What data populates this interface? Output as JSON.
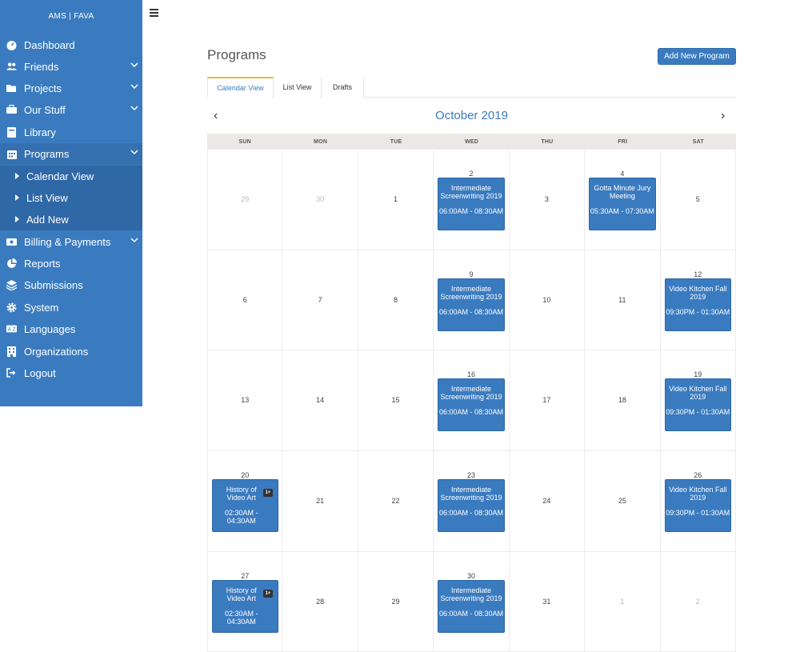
{
  "brand": "AMS  |  FAVA",
  "nav": {
    "dashboard": "Dashboard",
    "friends": "Friends",
    "projects": "Projects",
    "our_stuff": "Our Stuff",
    "library": "Library",
    "programs": "Programs",
    "sub": {
      "calendar_view": "Calendar View",
      "list_view": "List View",
      "add_new": "Add New"
    },
    "billing": "Billing & Payments",
    "reports": "Reports",
    "submissions": "Submissions",
    "system": "System",
    "languages": "Languages",
    "organizations": "Organizations",
    "logout": "Logout"
  },
  "header": {
    "title": "Programs",
    "add_button": "Add New Program"
  },
  "tabs": [
    "Calendar View",
    "List View",
    "Drafts"
  ],
  "calendar": {
    "month": "October 2019",
    "prev": "‹",
    "next": "›",
    "weekdays": [
      "SUN",
      "MON",
      "TUE",
      "WED",
      "THU",
      "FRI",
      "SAT"
    ],
    "weeks": [
      [
        "29",
        "30",
        "1",
        "2",
        "3",
        "4",
        "5"
      ],
      [
        "6",
        "7",
        "8",
        "9",
        "10",
        "11",
        "12"
      ],
      [
        "13",
        "14",
        "15",
        "16",
        "17",
        "18",
        "19"
      ],
      [
        "20",
        "21",
        "22",
        "23",
        "24",
        "25",
        "26"
      ],
      [
        "27",
        "28",
        "29",
        "30",
        "31",
        "1",
        "2"
      ]
    ],
    "events": {
      "e_2": {
        "title": "Intermediate Screenwriting 2019",
        "time": "06:00AM - 08:30AM"
      },
      "e_4": {
        "title": "Gotta Minute Jury Meeting",
        "time": "05:30AM - 07:30AM"
      },
      "e_9": {
        "title": "Intermediate Screenwriting 2019",
        "time": "06:00AM - 08:30AM"
      },
      "e_12": {
        "title": "Video Kitchen Fall 2019",
        "time": "09:30PM - 01:30AM"
      },
      "e_16": {
        "title": "Intermediate Screenwriting 2019",
        "time": "06:00AM - 08:30AM"
      },
      "e_19": {
        "title": "Video Kitchen Fall 2019",
        "time": "09:30PM - 01:30AM"
      },
      "e_20": {
        "title": "History of Video Art",
        "time": "02:30AM - 04:30AM",
        "badge": "1+"
      },
      "e_23": {
        "title": "Intermediate Screenwriting 2019",
        "time": "06:00AM - 08:30AM"
      },
      "e_26": {
        "title": "Video Kitchen Fall 2019",
        "time": "09:30PM - 01:30AM"
      },
      "e_27": {
        "title": "History of Video Art",
        "time": "02:30AM - 04:30AM",
        "badge": "1+"
      },
      "e_30": {
        "title": "Intermediate Screenwriting 2019",
        "time": "06:00AM - 08:30AM"
      }
    }
  },
  "colors": {
    "sidebar": "#3a7bc0",
    "accent": "#3a7bc0",
    "tab_active_border": "#f0b23c"
  }
}
